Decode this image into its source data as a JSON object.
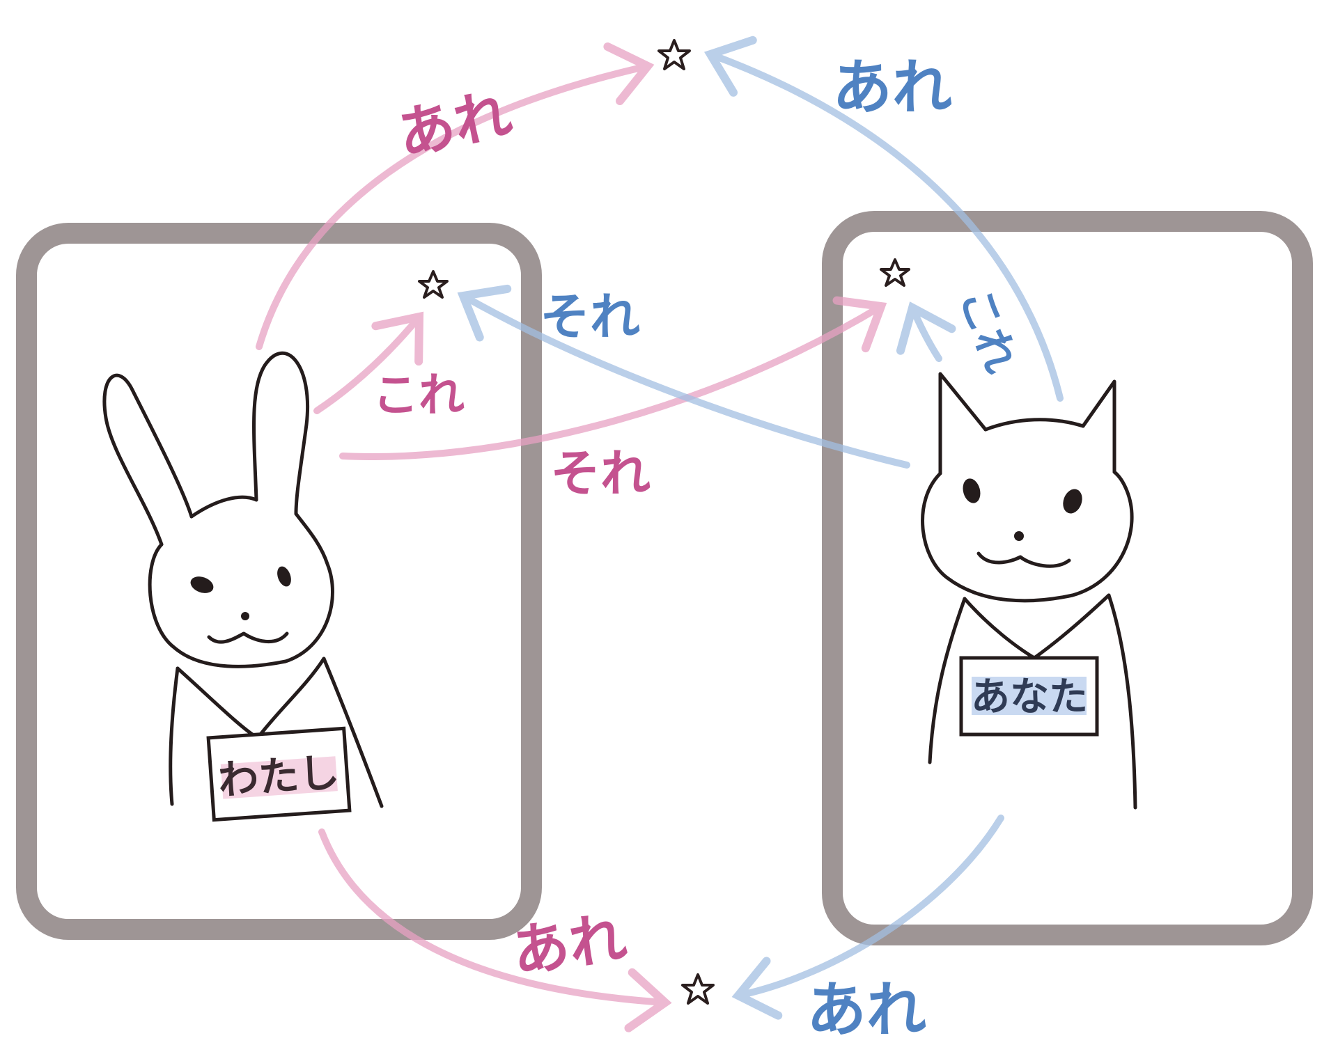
{
  "colors": {
    "speaker": "#c4528f",
    "listener": "#4f82c2",
    "speaker_arrow": "#e8a2c3",
    "listener_arrow": "#a3bfe2",
    "territory_box": "#8d8282",
    "ink": "#241c1c"
  },
  "characters": {
    "speaker": {
      "animal": "rabbit",
      "tag": "わたし"
    },
    "listener": {
      "animal": "cat",
      "tag": "あなた"
    }
  },
  "labels": {
    "speaker_top_are": "あれ",
    "speaker_kore": "これ",
    "speaker_sore": "それ",
    "speaker_bottom_are": "あれ",
    "listener_top_are": "あれ",
    "listener_sore": "それ",
    "listener_kore": "これ",
    "listener_bottom_are": "あれ"
  },
  "icons": [
    "star-icon",
    "rabbit-icon",
    "cat-icon"
  ]
}
